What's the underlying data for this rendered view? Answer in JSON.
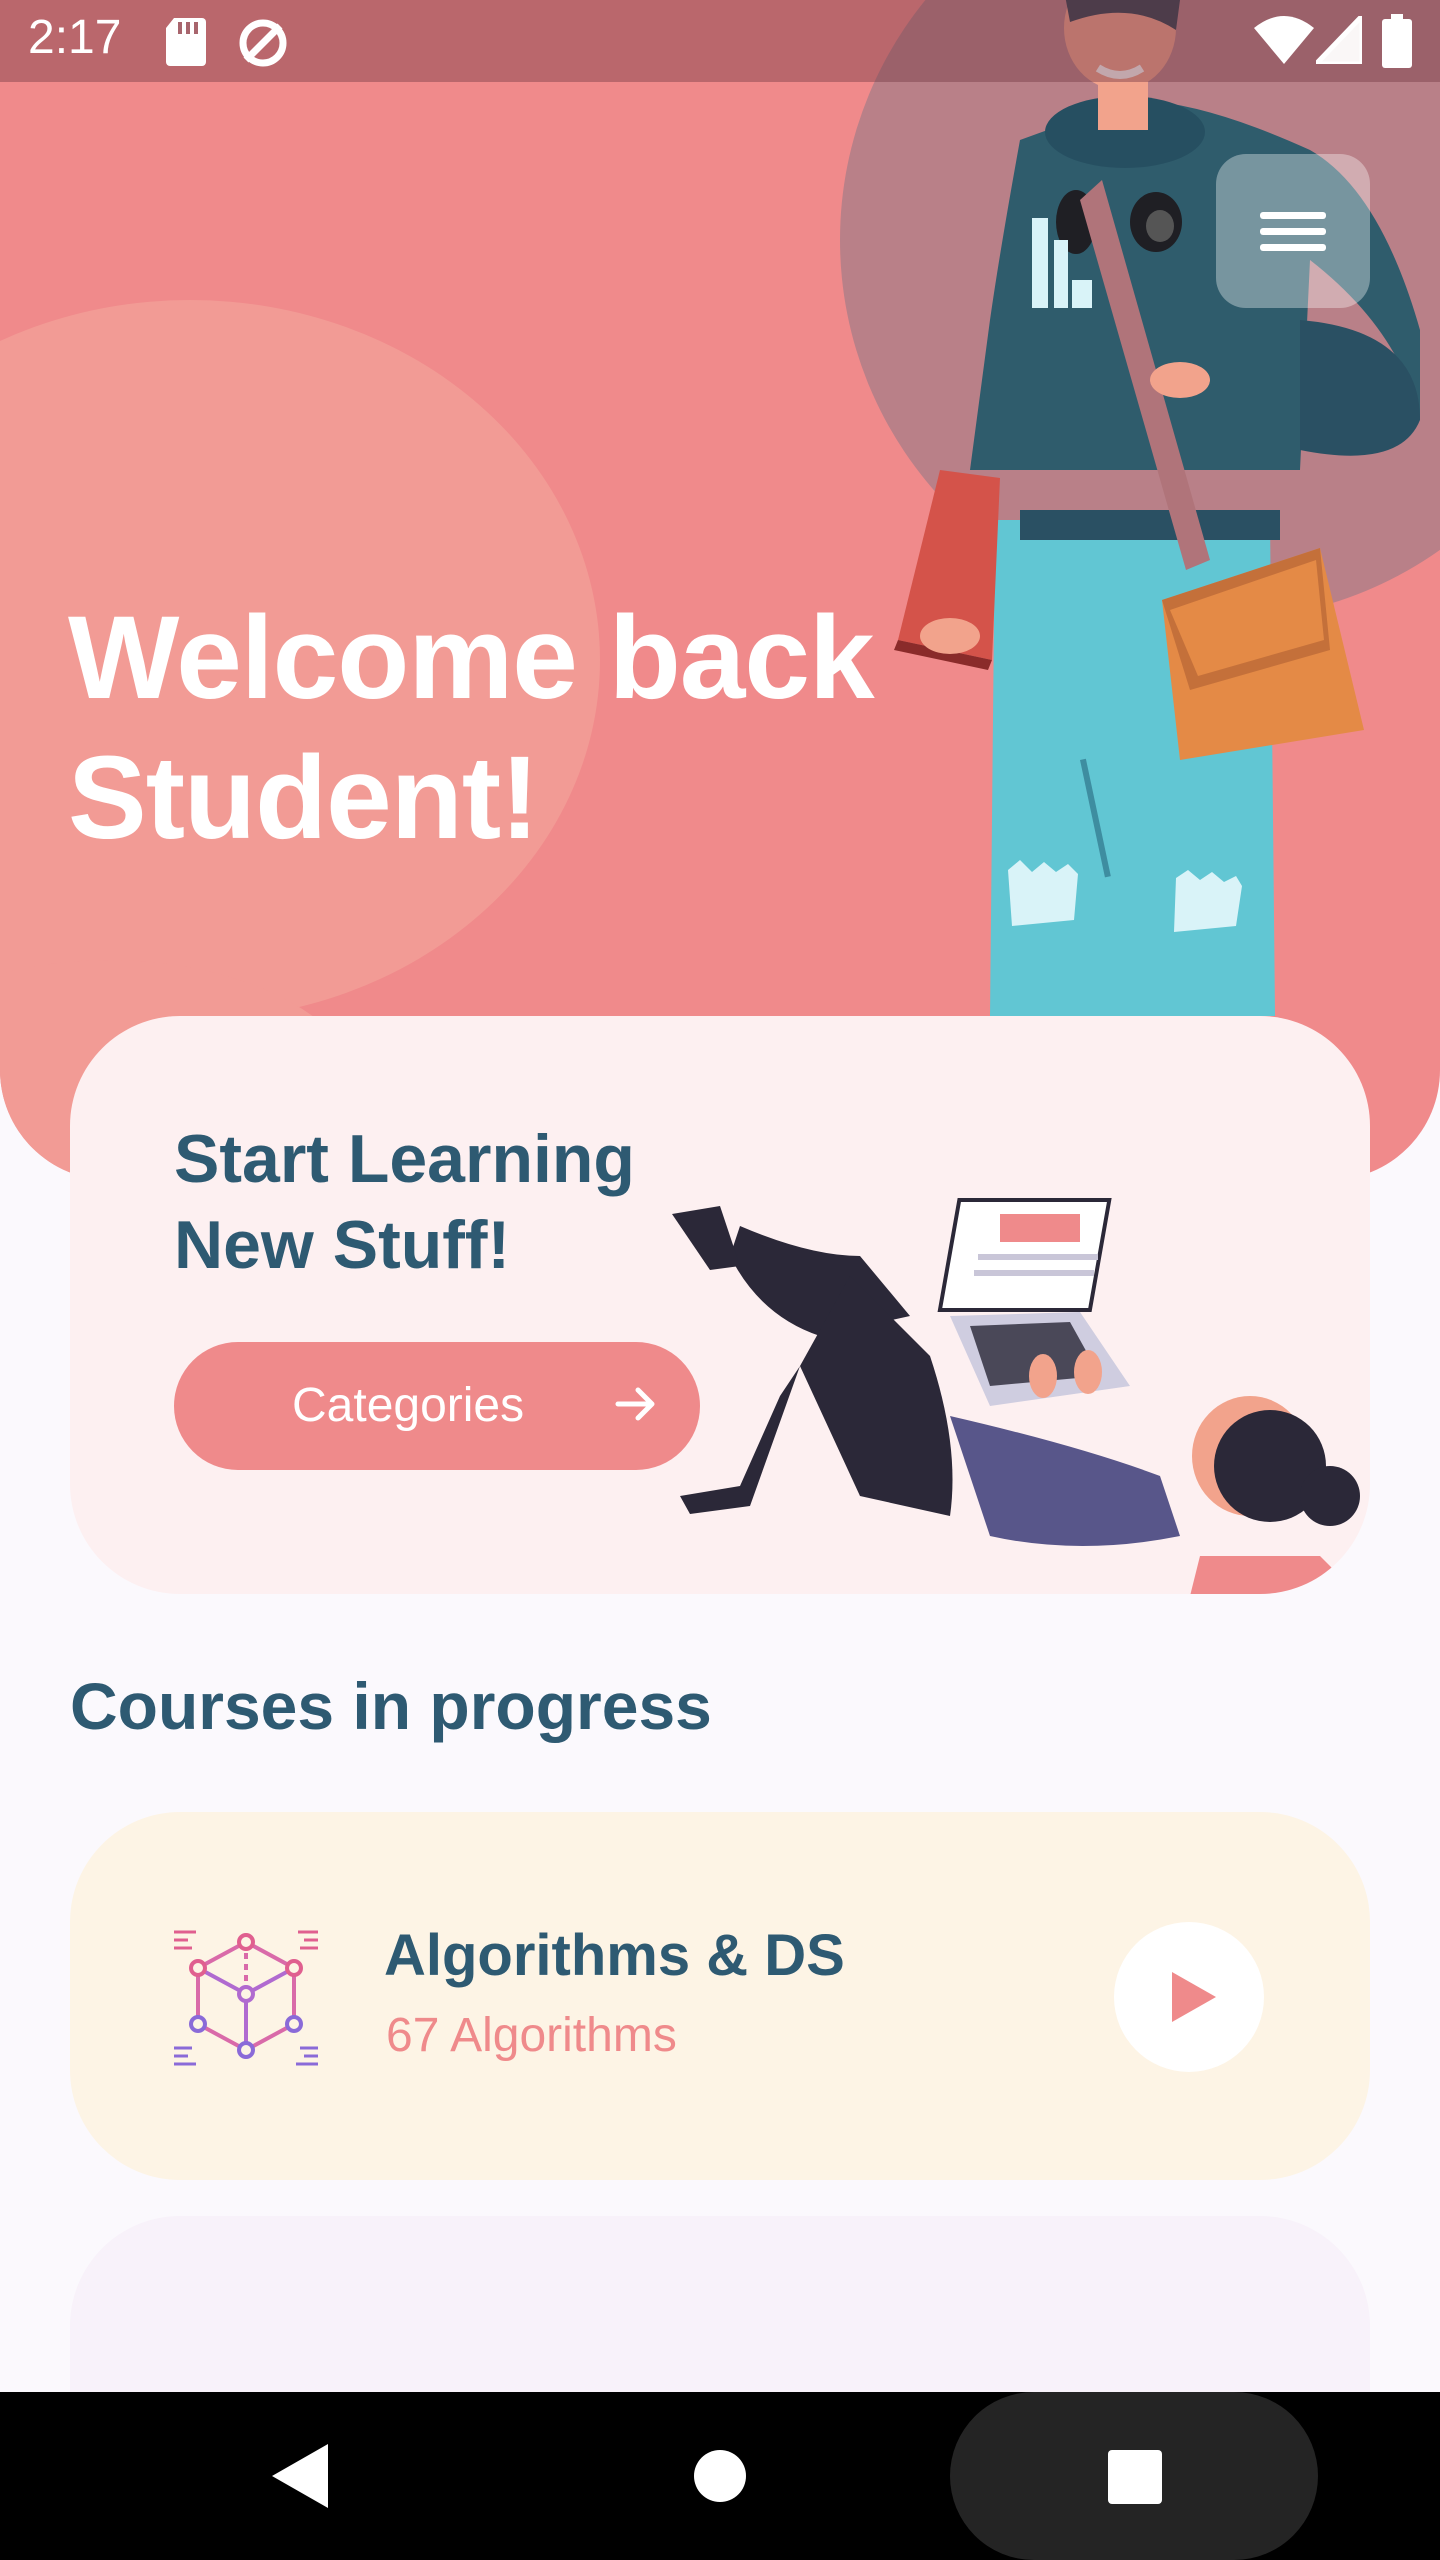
{
  "status_bar": {
    "time": "2:17",
    "icons": [
      "sd-card-icon",
      "sync-icon",
      "wifi-icon",
      "signal-icon",
      "battery-icon"
    ]
  },
  "hero": {
    "welcome_title_line1": "Welcome back",
    "welcome_title_line2": "Student!"
  },
  "learn_card": {
    "title_line1": "Start Learning",
    "title_line2": "New Stuff!",
    "button_label": "Categories"
  },
  "courses": {
    "heading": "Courses in progress",
    "items": [
      {
        "title": "Algorithms & DS",
        "subtitle": "67 Algorithms"
      }
    ]
  },
  "colors": {
    "accent": "#ef8a8b",
    "heading": "#2e5a72",
    "card_pink": "#fdf0f1",
    "card_cream": "#fdf4e5"
  }
}
